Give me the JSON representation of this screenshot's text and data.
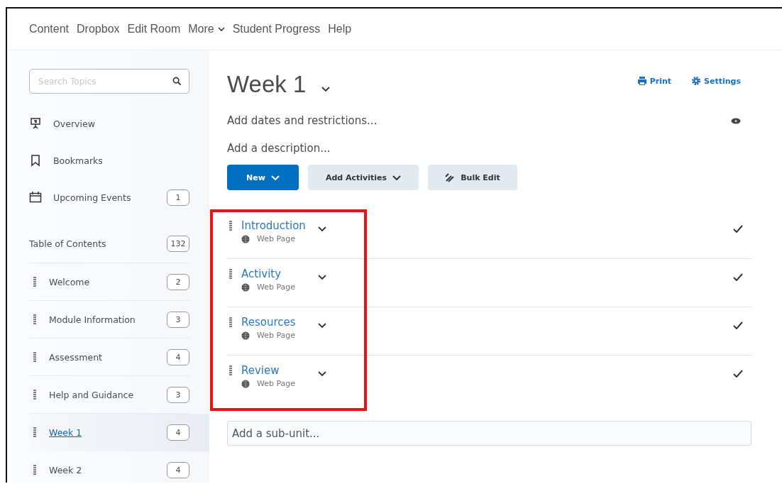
{
  "nav": [
    {
      "label": "Content",
      "kind": "link"
    },
    {
      "label": "Dropbox",
      "kind": "link"
    },
    {
      "label": "Edit Room",
      "kind": "link"
    },
    {
      "label": "More",
      "kind": "menu"
    },
    {
      "label": "Student Progress",
      "kind": "link"
    },
    {
      "label": "Help",
      "kind": "link"
    }
  ],
  "sidebar": {
    "search": {
      "placeholder": "Search Topics"
    },
    "quick_links": [
      {
        "label": "Overview"
      },
      {
        "label": "Bookmarks"
      },
      {
        "label": "Upcoming Events",
        "count": "1"
      }
    ],
    "table_of_contents": {
      "label": "Table of Contents",
      "count": "132"
    },
    "modules": [
      {
        "label": "Welcome",
        "count": "2",
        "selected": false
      },
      {
        "label": "Module Information",
        "count": "3",
        "selected": false
      },
      {
        "label": "Assessment",
        "count": "4",
        "selected": false
      },
      {
        "label": "Help and Guidance",
        "count": "3",
        "selected": false
      },
      {
        "label": "Week 1",
        "count": "4",
        "selected": true
      },
      {
        "label": "Week 2",
        "count": "4",
        "selected": false
      }
    ]
  },
  "main": {
    "title": "Week 1",
    "actions": [
      "Print",
      "Settings"
    ],
    "dates": "Add dates and restrictions...",
    "description": "Add a description...",
    "buttons": [
      {
        "label": "New",
        "kind": "primary"
      },
      {
        "label": "Add Activities",
        "kind": "dropdown"
      },
      {
        "label": "Bulk Edit",
        "kind": "edit"
      }
    ],
    "topics": [
      {
        "title": "Introduction",
        "type": "Web Page"
      },
      {
        "title": "Activity",
        "type": "Web Page"
      },
      {
        "title": "Resources",
        "type": "Web Page"
      },
      {
        "title": "Review",
        "type": "Web Page"
      }
    ],
    "sub_unit": {
      "placeholder": "Add a sub-unit..."
    }
  }
}
